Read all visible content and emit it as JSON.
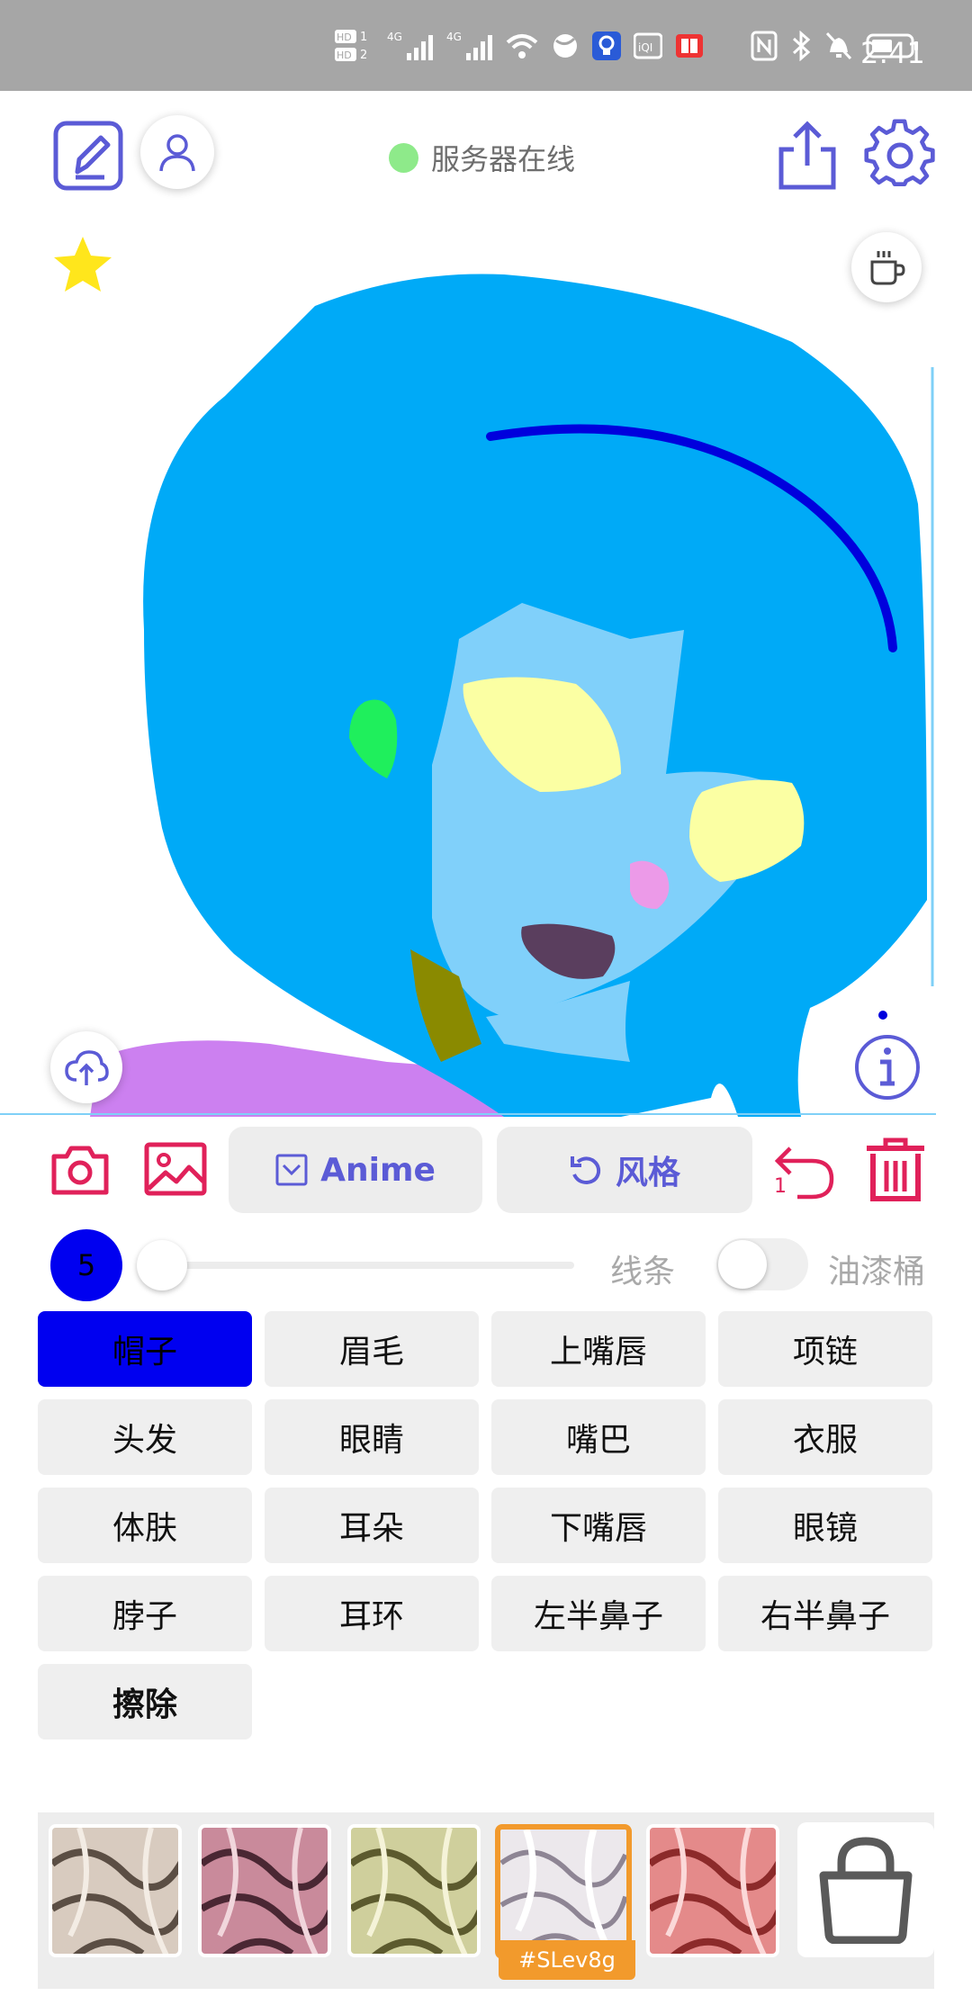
{
  "status_bar": {
    "time": "2:41",
    "sim1": "HD 1",
    "sim2": "HD 2",
    "net1": "4G",
    "net2": "4G"
  },
  "header": {
    "server_status": "服务器在线",
    "server_color": "#8eea8a",
    "accent": "#5b5bd6"
  },
  "toolbar": {
    "anime_label": "Anime",
    "style_label": "风格",
    "undo_count": "1"
  },
  "brush": {
    "size": "5",
    "line_label": "线条",
    "bucket_label": "油漆桶",
    "slider_fraction": 0.0,
    "bucket_enabled": false
  },
  "parts": {
    "items": [
      "帽子",
      "眉毛",
      "上嘴唇",
      "项链",
      "头发",
      "眼睛",
      "嘴巴",
      "衣服",
      "体肤",
      "耳朵",
      "下嘴唇",
      "眼镜",
      "脖子",
      "耳环",
      "左半鼻子",
      "右半鼻子",
      "擦除"
    ],
    "selected": "帽子",
    "selected_color": "#0000f0"
  },
  "styles": {
    "active_tag": "#SLev8g"
  },
  "icons": [
    "edit-icon",
    "user-icon",
    "share-icon",
    "gear-icon",
    "star-icon",
    "coffee-icon",
    "cloud-upload-icon",
    "info-icon",
    "camera-icon",
    "image-icon",
    "undo-icon",
    "trash-icon",
    "bag-icon"
  ]
}
